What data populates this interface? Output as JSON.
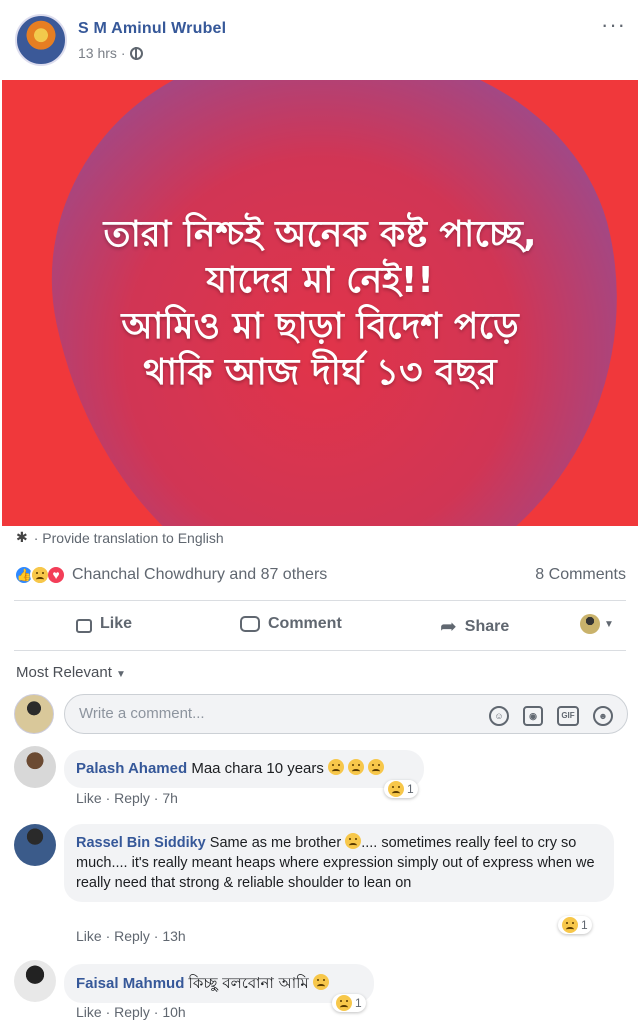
{
  "post": {
    "author": "S M Aminul Wrubel",
    "time": "13 hrs",
    "more": "···",
    "image_text": [
      "তারা নিশ্চই অনেক কষ্ট পাচ্ছে,",
      "যাদের মা নেই!!",
      "আমিও মা ছাড়া বিদেশ পড়ে",
      "থাকি আজ দীর্ঘ ১৩ বছর"
    ],
    "translate": "· Provide translation to English",
    "reactors": "Chanchal Chowdhury and 87 others",
    "comments_count": "8 Comments"
  },
  "actions": {
    "like": "Like",
    "comment": "Comment",
    "share": "Share"
  },
  "colors": {
    "hero_bg": "#f0383b",
    "link": "#365899"
  },
  "comments_header": {
    "sort": "Most Relevant"
  },
  "composer": {
    "placeholder": "Write a comment..."
  },
  "comments": [
    {
      "name": "Palash Ahamed",
      "text": "Maa chara 10 years",
      "links": "Like · Reply · 7h",
      "reactions": "1"
    },
    {
      "name": "Rassel Bin Siddiky",
      "text_a": "Same as me brother",
      "text_b": ".... sometimes really feel to cry so much.... it's really meant heaps where expression simply out of express when we really need that strong & reliable shoulder to lean on",
      "links": "Like · Reply · 13h",
      "reactions": "1"
    },
    {
      "name": "Faisal Mahmud",
      "text": "কিচ্ছু বলবোনা আমি",
      "links": "Like · Reply · 10h",
      "reactions": "1"
    }
  ]
}
